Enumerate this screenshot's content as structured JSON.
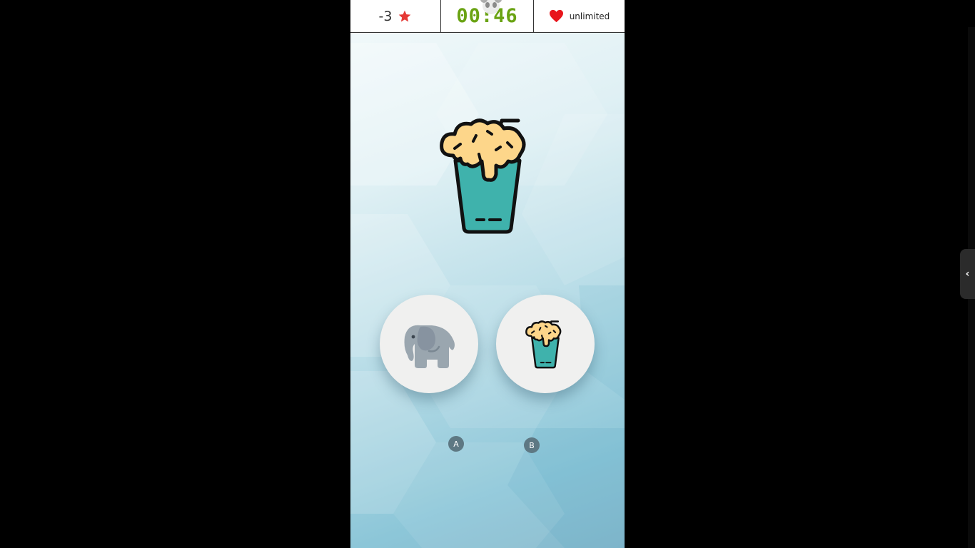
{
  "header": {
    "score": "-3",
    "score_icon": "star-icon",
    "timer": "00:46",
    "lives_icon": "heart-icon",
    "lives": "unlimited"
  },
  "prompt": {
    "icon": "milkshake-icon"
  },
  "choices": [
    {
      "key": "A",
      "icon": "elephant-icon"
    },
    {
      "key": "B",
      "icon": "milkshake-icon"
    }
  ],
  "side_panel": {
    "toggle_icon": "chevron-left-icon"
  },
  "colors": {
    "timer_green": "#6aa313",
    "star_red": "#e53935",
    "heart_red": "#e8151b",
    "cup_teal": "#3fb2ac",
    "foam_yellow": "#fdd68a",
    "elephant_gray": "#9aa6af",
    "key_badge": "#5e7883"
  }
}
